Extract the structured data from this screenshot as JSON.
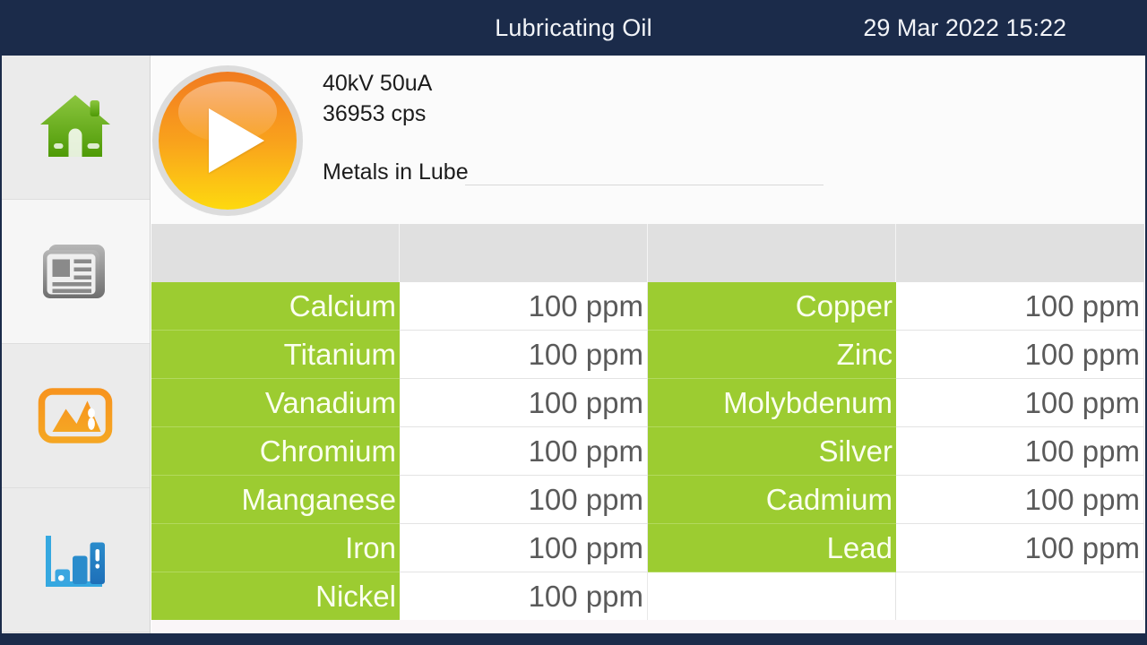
{
  "titlebar": {
    "title": "Lubricating Oil",
    "datetime": "29 Mar 2022 15:22"
  },
  "sidebar": {
    "items": [
      {
        "icon": "home-icon",
        "name": "sidebar-item-home",
        "active": false
      },
      {
        "icon": "report-icon",
        "name": "sidebar-item-results",
        "active": true
      },
      {
        "icon": "image-icon",
        "name": "sidebar-item-image",
        "active": false
      },
      {
        "icon": "chart-icon",
        "name": "sidebar-item-chart",
        "active": false
      }
    ]
  },
  "info": {
    "play_label": "play-icon",
    "tube_settings": "40kV 50uA",
    "count_rate": "36953 cps",
    "method": "Metals in Lube"
  },
  "results": {
    "unit": "ppm",
    "columns": [
      "",
      "",
      "",
      ""
    ],
    "rows": [
      {
        "left_name": "Calcium",
        "left_value": "100 ppm",
        "right_name": "Copper",
        "right_value": "100 ppm"
      },
      {
        "left_name": "Titanium",
        "left_value": "100 ppm",
        "right_name": "Zinc",
        "right_value": "100 ppm"
      },
      {
        "left_name": "Vanadium",
        "left_value": "100 ppm",
        "right_name": "Molybdenum",
        "right_value": "100 ppm"
      },
      {
        "left_name": "Chromium",
        "left_value": "100 ppm",
        "right_name": "Silver",
        "right_value": "100 ppm"
      },
      {
        "left_name": "Manganese",
        "left_value": "100 ppm",
        "right_name": "Cadmium",
        "right_value": "100 ppm"
      },
      {
        "left_name": "Iron",
        "left_value": "100 ppm",
        "right_name": "Lead",
        "right_value": "100 ppm"
      },
      {
        "left_name": "Nickel",
        "left_value": "100 ppm",
        "right_name": "",
        "right_value": ""
      }
    ]
  },
  "colors": {
    "header_bar": "#1b2b4a",
    "element_green": "#9ccc31",
    "value_text": "#5a5a5a",
    "play_orange": "#f58b1f",
    "play_yellow": "#fdd90f"
  }
}
